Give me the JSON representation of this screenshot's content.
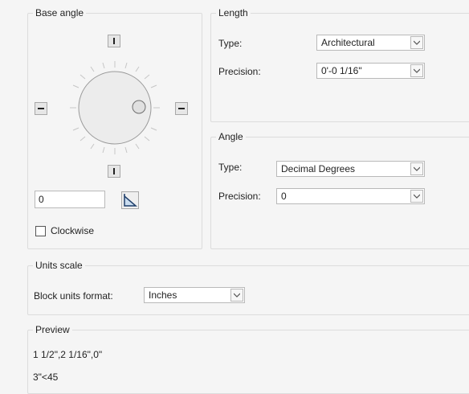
{
  "base_angle": {
    "title": "Base angle",
    "angle_value": "0",
    "clockwise_label": "Clockwise",
    "clockwise_checked": false
  },
  "length": {
    "title": "Length",
    "type_label": "Type:",
    "type_value": "Architectural",
    "precision_label": "Precision:",
    "precision_value": "0'-0 1/16\""
  },
  "angle": {
    "title": "Angle",
    "type_label": "Type:",
    "type_value": "Decimal Degrees",
    "precision_label": "Precision:",
    "precision_value": "0"
  },
  "units_scale": {
    "title": "Units scale",
    "block_units_label": "Block units format:",
    "block_units_value": "Inches"
  },
  "preview": {
    "title": "Preview",
    "line1": "1 1/2\",2 1/16\",0\"",
    "line2": "3\"<45"
  },
  "icons": {
    "pick_angle": "pick-angle-icon",
    "dropdown": "chevron-down-icon"
  }
}
